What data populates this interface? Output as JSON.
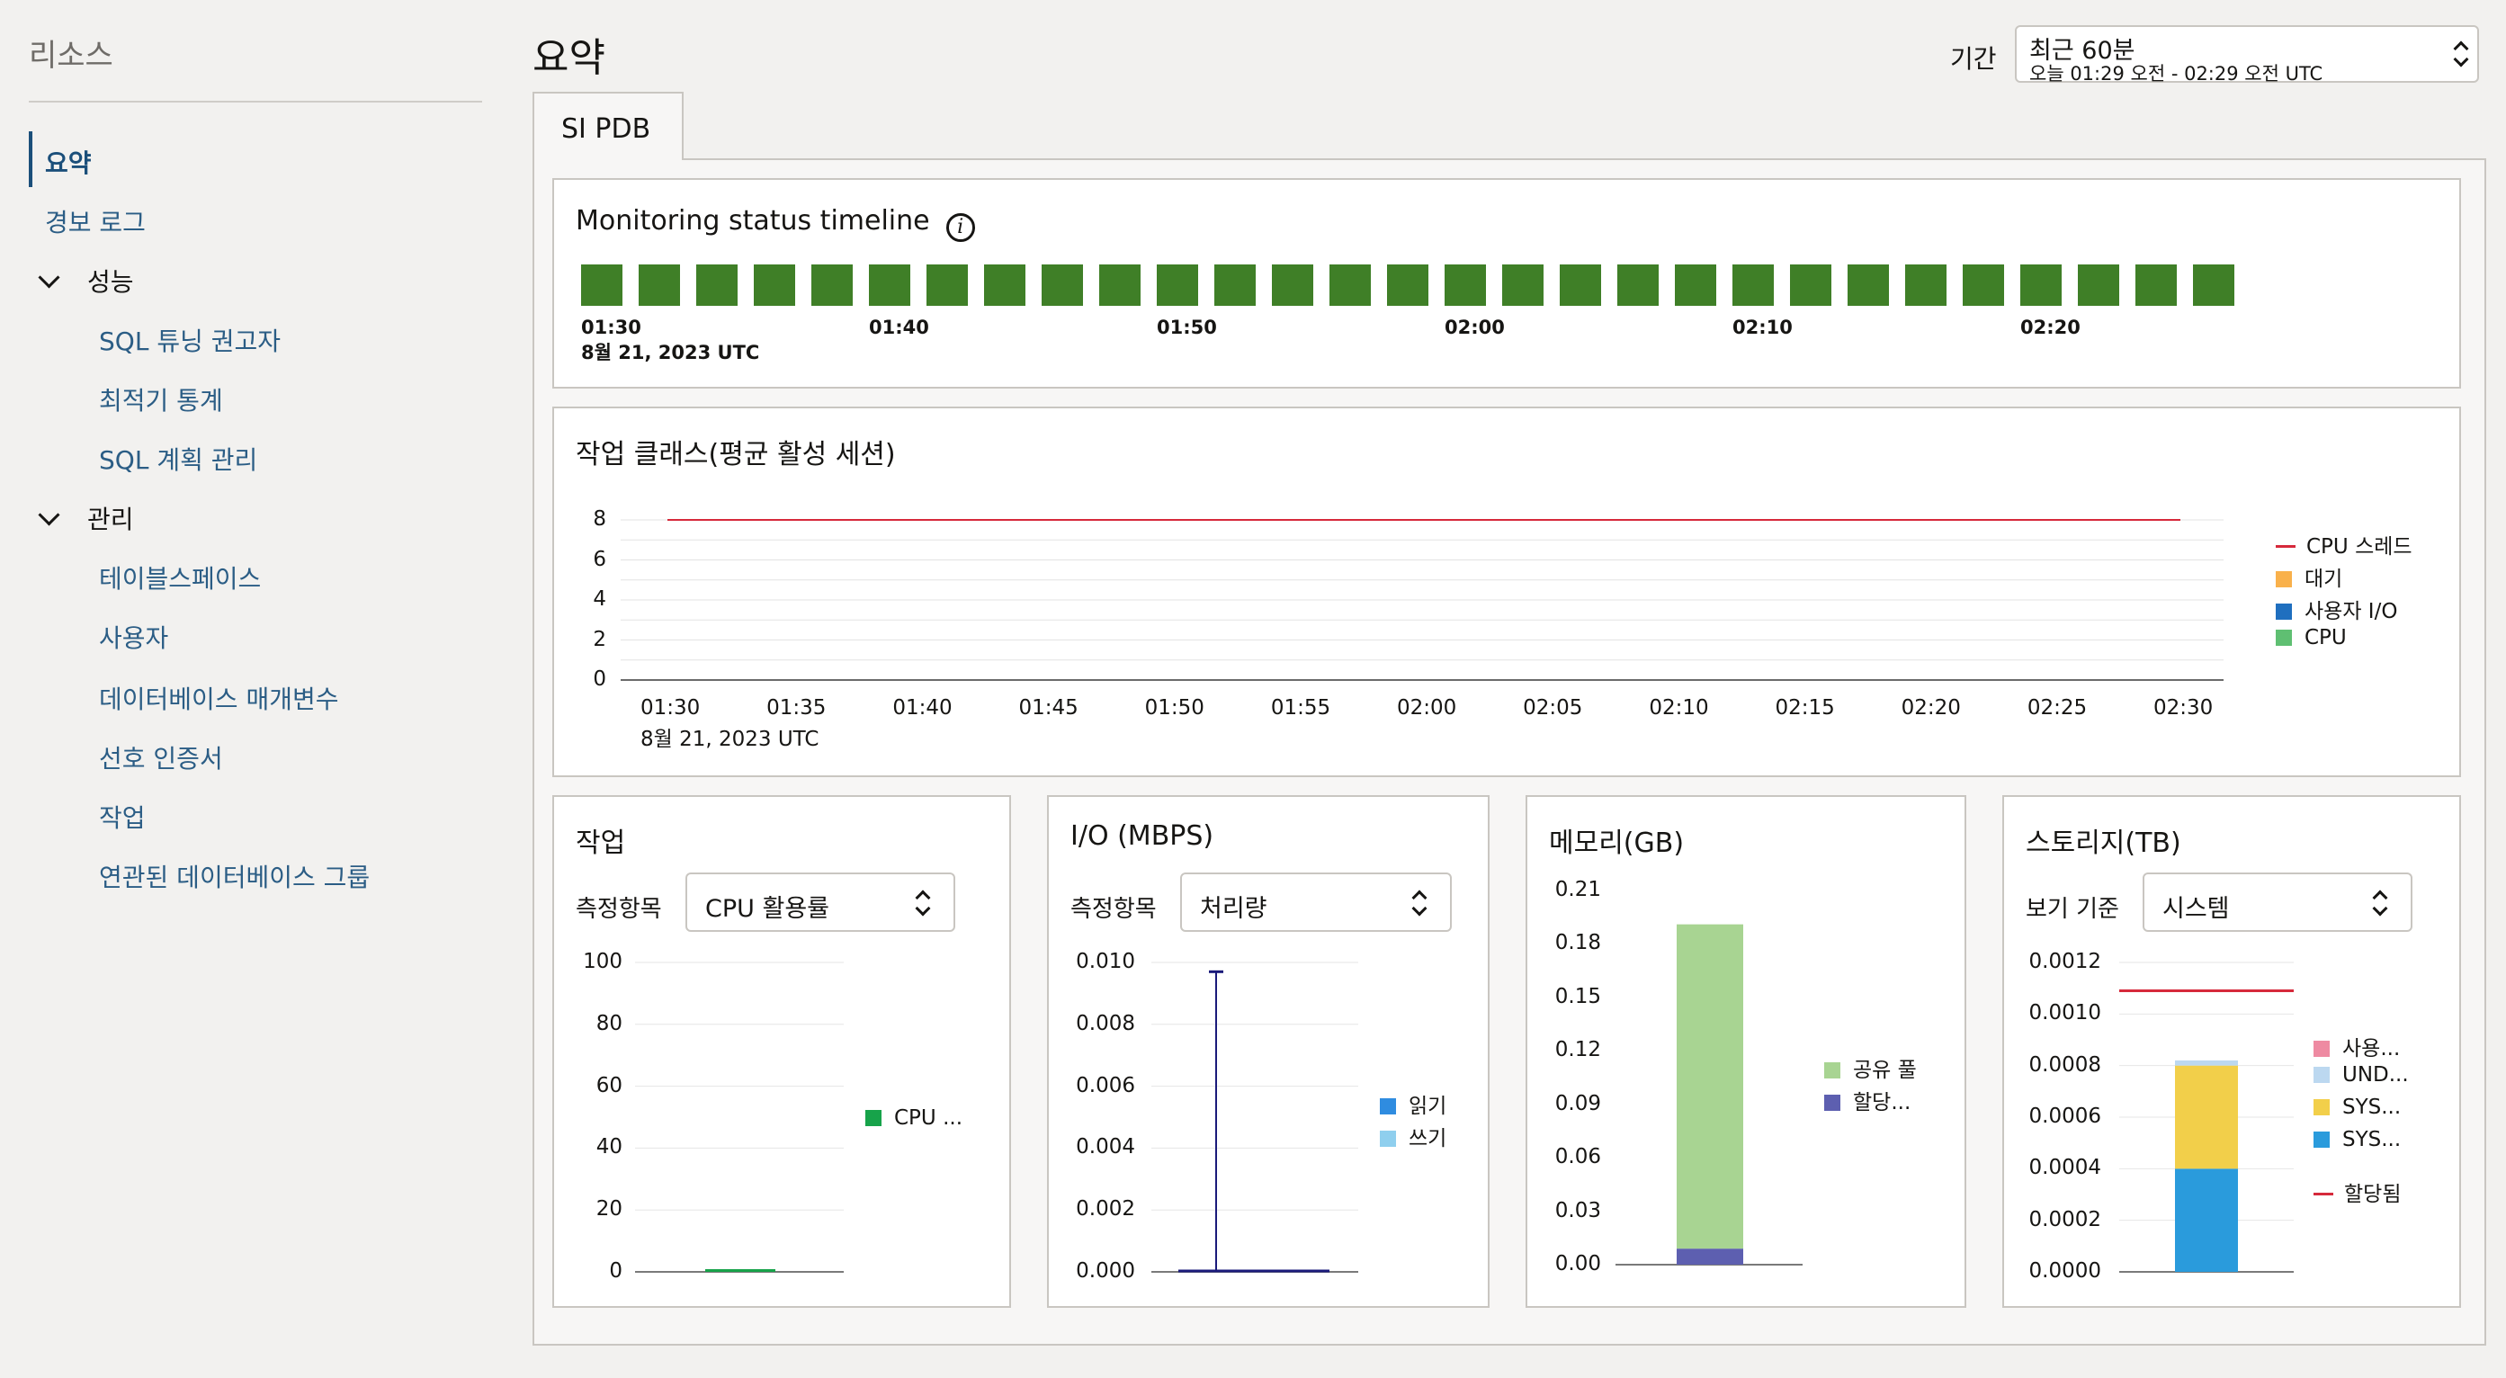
{
  "sidebar": {
    "title": "리소스",
    "items": [
      {
        "label": "요약",
        "active": true
      },
      {
        "label": "경보 로그"
      },
      {
        "label": "성능",
        "group": true
      },
      {
        "label": "SQL 튜닝 권고자"
      },
      {
        "label": "최적기 통계"
      },
      {
        "label": "SQL 계획 관리"
      },
      {
        "label": "관리",
        "group": true
      },
      {
        "label": "테이블스페이스"
      },
      {
        "label": "사용자"
      },
      {
        "label": "데이터베이스 매개변수"
      },
      {
        "label": "선호 인증서"
      },
      {
        "label": "작업"
      },
      {
        "label": "연관된 데이터베이스 그룹"
      }
    ]
  },
  "header": {
    "title": "요약",
    "period_label": "기간",
    "period_value": "최근 60분",
    "period_range": "오늘 01:29 오전 - 02:29 오전 UTC"
  },
  "tab": {
    "label": "SI PDB"
  },
  "timeline": {
    "title": "Monitoring status timeline",
    "block_count": 29,
    "block_color": "#3f7f27",
    "tick_labels": [
      "01:30",
      "01:40",
      "01:50",
      "02:00",
      "02:10",
      "02:20"
    ],
    "date_label": "8월 21, 2023 UTC"
  },
  "workload": {
    "title": "작업 클래스(평균 활성 세션)",
    "date_label": "8월 21, 2023 UTC",
    "chart_data": {
      "type": "line",
      "x": [
        "01:30",
        "01:35",
        "01:40",
        "01:45",
        "01:50",
        "01:55",
        "02:00",
        "02:05",
        "02:10",
        "02:15",
        "02:20",
        "02:25",
        "02:30"
      ],
      "y_ticks": [
        "8",
        "6",
        "4",
        "2",
        "0"
      ],
      "ylim": [
        0,
        8
      ],
      "series": [
        {
          "name": "CPU 스레드",
          "kind": "line",
          "color": "#d6293b",
          "values": [
            8,
            8,
            8,
            8,
            8,
            8,
            8,
            8,
            8,
            8,
            8,
            8,
            8
          ]
        },
        {
          "name": "대기",
          "kind": "area",
          "color": "#f9b14b",
          "values": [
            0,
            0,
            0,
            0,
            0,
            0,
            0,
            0,
            0,
            0,
            0,
            0,
            0
          ]
        },
        {
          "name": "사용자 I/O",
          "kind": "area",
          "color": "#1f6fbf",
          "values": [
            0,
            0,
            0,
            0,
            0,
            0,
            0,
            0,
            0,
            0,
            0,
            0,
            0
          ]
        },
        {
          "name": "CPU",
          "kind": "area",
          "color": "#5fbf72",
          "values": [
            0,
            0,
            0,
            0,
            0,
            0,
            0,
            0,
            0,
            0,
            0,
            0,
            0
          ]
        }
      ]
    }
  },
  "cards": {
    "job": {
      "title": "작업",
      "metric_label": "측정항목",
      "metric_value": "CPU 활용률",
      "chart_data": {
        "type": "bar",
        "y_ticks": [
          "100",
          "80",
          "60",
          "40",
          "20",
          "0"
        ],
        "ylim": [
          0,
          100
        ],
        "series": [
          {
            "name": "CPU ...",
            "color": "#17a34a",
            "values": [
              0.5
            ]
          }
        ]
      }
    },
    "io": {
      "title": "I/O (MBPS)",
      "metric_label": "측정항목",
      "metric_value": "처리량",
      "chart_data": {
        "type": "line",
        "y_ticks": [
          "0.010",
          "0.008",
          "0.006",
          "0.004",
          "0.002",
          "0.000"
        ],
        "ylim": [
          0,
          0.01
        ],
        "spike_value": 0.0097,
        "series": [
          {
            "name": "읽기",
            "color": "#2f8ce0"
          },
          {
            "name": "쓰기",
            "color": "#8fcfee"
          }
        ]
      }
    },
    "memory": {
      "title": "메모리(GB)",
      "chart_data": {
        "type": "bar",
        "y_ticks": [
          "0.21",
          "0.18",
          "0.15",
          "0.12",
          "0.09",
          "0.06",
          "0.03",
          "0.00"
        ],
        "ylim": [
          0,
          0.21
        ],
        "series": [
          {
            "name": "공유 풀",
            "color": "#a8d492",
            "values": [
              0.182
            ]
          },
          {
            "name": "할당...",
            "color": "#5d5fb0",
            "values": [
              0.009
            ]
          }
        ]
      }
    },
    "storage": {
      "title": "스토리지(TB)",
      "view_label": "보기 기준",
      "view_value": "시스템",
      "chart_data": {
        "type": "bar",
        "y_ticks": [
          "0.0012",
          "0.0010",
          "0.0008",
          "0.0006",
          "0.0004",
          "0.0002",
          "0.0000"
        ],
        "ylim": [
          0,
          0.0012
        ],
        "allocated_line": 0.00109,
        "series": [
          {
            "name": "사용...",
            "color": "#ee8aa2",
            "values": [
              0
            ]
          },
          {
            "name": "UND...",
            "color": "#bcd8f0",
            "values": [
              2e-05
            ]
          },
          {
            "name": "SYS...",
            "color": "#f2cf4a",
            "values": [
              0.0004
            ]
          },
          {
            "name": "SYS...",
            "color": "#2a9bdc",
            "values": [
              0.0004
            ]
          },
          {
            "name": "할당됨",
            "color": "#d6293b",
            "kind": "line"
          }
        ]
      }
    }
  }
}
